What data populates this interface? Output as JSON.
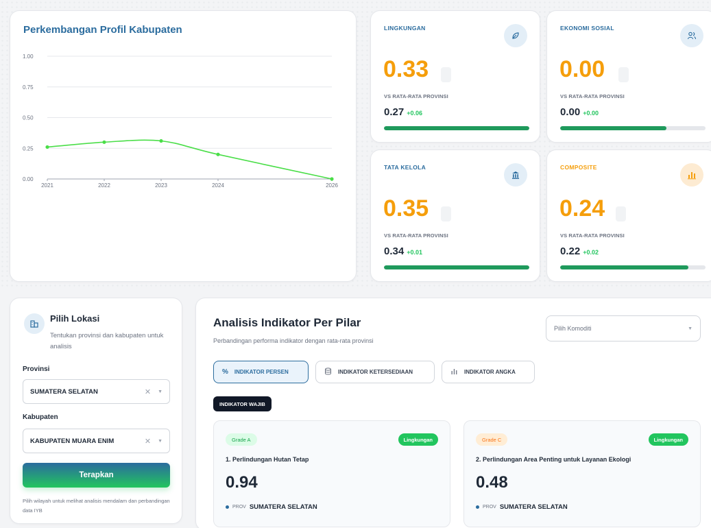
{
  "chart_card": {
    "title": "Perkembangan Profil Kabupaten"
  },
  "chart_data": {
    "type": "line",
    "title": "Perkembangan Profil Kabupaten",
    "x": [
      "2021",
      "2022",
      "2023",
      "2024",
      "2026"
    ],
    "series": [
      {
        "values": [
          0.26,
          0.3,
          0.31,
          0.2,
          0.0
        ]
      }
    ],
    "y_ticks": [
      "0.00",
      "0.25",
      "0.50",
      "0.75",
      "1.00"
    ],
    "ylim": [
      0,
      1
    ],
    "grid": true,
    "line_color": "#4ade48"
  },
  "stats": [
    {
      "label": "LINGKUNGAN",
      "value": "0.33",
      "vs": "VS RATA-RATA PROVINSI",
      "prov": "0.27",
      "delta": "+0.06",
      "progress": 1.0,
      "icon": "leaf-icon"
    },
    {
      "label": "EKONOMI SOSIAL",
      "value": "0.00",
      "vs": "VS RATA-RATA PROVINSI",
      "prov": "0.00",
      "delta": "+0.00",
      "progress": 0.73,
      "icon": "users-icon"
    },
    {
      "label": "TATA KELOLA",
      "value": "0.35",
      "vs": "VS RATA-RATA PROVINSI",
      "prov": "0.34",
      "delta": "+0.01",
      "progress": 1.0,
      "icon": "building-icon"
    },
    {
      "label": "COMPOSITE",
      "value": "0.24",
      "vs": "VS RATA-RATA PROVINSI",
      "prov": "0.22",
      "delta": "+0.02",
      "progress": 0.88,
      "icon": "bar-chart-icon"
    }
  ],
  "location": {
    "title": "Pilih Lokasi",
    "subtitle": "Tentukan provinsi dan kabupaten untuk analisis",
    "provinsi_label": "Provinsi",
    "provinsi_value": "SUMATERA SELATAN",
    "kabupaten_label": "Kabupaten",
    "kabupaten_value": "KABUPATEN MUARA ENIM",
    "apply_label": "Terapkan",
    "note": "Pilih wilayah untuk melihat analisis mendalam dan perbandingan data IYB"
  },
  "analysis": {
    "title": "Analisis Indikator Per Pilar",
    "subtitle": "Perbandingan performa indikator dengan rata-rata provinsi",
    "komoditi_placeholder": "Pilih Komoditi",
    "tabs": [
      "INDIKATOR PERSEN",
      "INDIKATOR KETERSEDIAAN",
      "INDIKATOR ANGKA"
    ],
    "active_tab": "INDIKATOR PERSEN",
    "section_pill": "INDIKATOR WAJIB",
    "indicators": [
      {
        "grade": "Grade A",
        "pillar": "Lingkungan",
        "name": "1. Perlindungan Hutan Tetap",
        "value": "0.94",
        "prov_label": "PROV",
        "prov_value": "SUMATERA SELATAN"
      },
      {
        "grade": "Grade C",
        "pillar": "Lingkungan",
        "name": "2. Perlindungan Area Penting untuk Layanan Ekologi",
        "value": "0.48",
        "prov_label": "PROV",
        "prov_value": "SUMATERA SELATAN"
      }
    ]
  }
}
